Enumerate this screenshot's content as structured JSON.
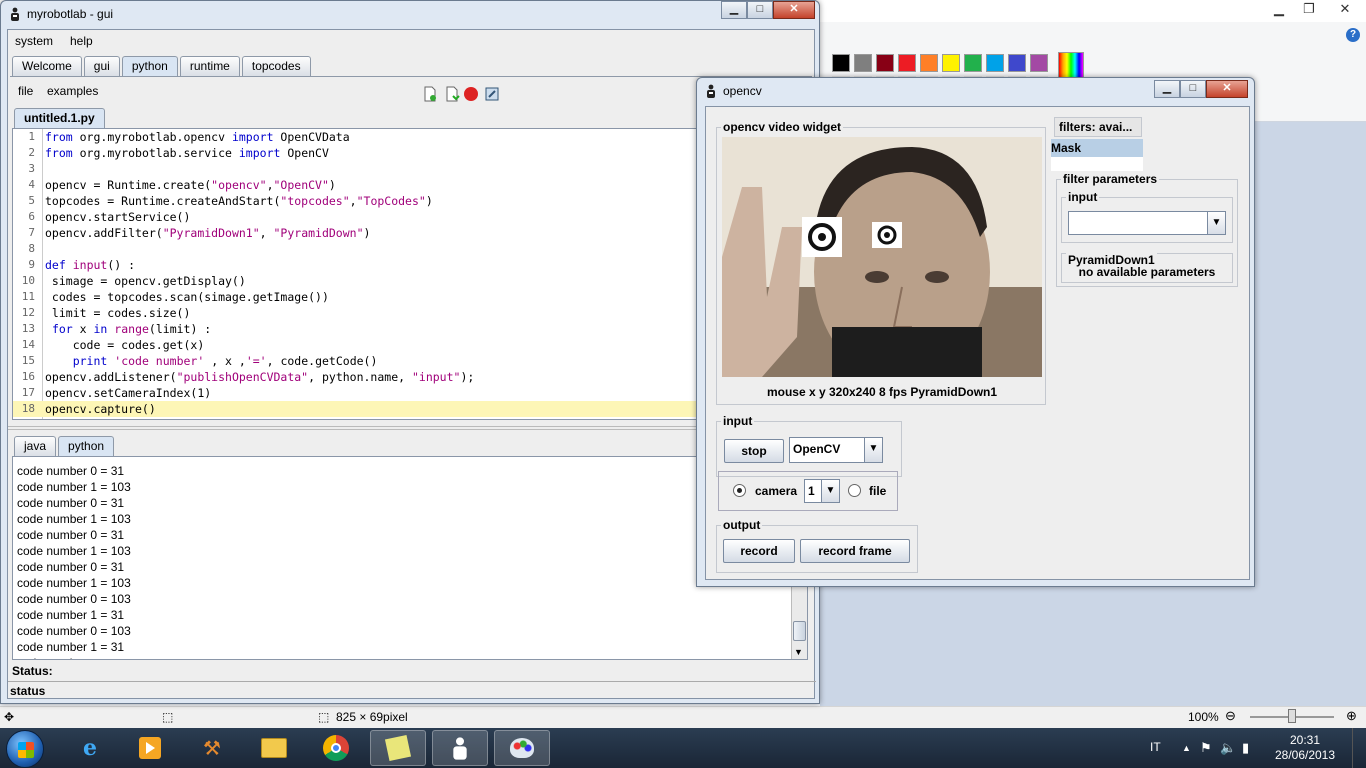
{
  "paint": {
    "colors": [
      "#000000",
      "#7f7f7f",
      "#880015",
      "#ed1c24",
      "#ff7f27",
      "#fff200",
      "#22b14c",
      "#00a2e8",
      "#3f48cc",
      "#a349a4"
    ],
    "status": {
      "size": "825 × 69pixel",
      "zoom": "100%",
      "zoom_level": 0.5
    }
  },
  "mrl": {
    "title": "myrobotlab - gui",
    "menu": [
      "system",
      "help"
    ],
    "tabs": [
      "Welcome",
      "gui",
      "python",
      "runtime",
      "topcodes"
    ],
    "selected_tab": "python",
    "submenu": [
      "file",
      "examples"
    ],
    "file_tab": "untitled.1.py",
    "code": [
      "from org.myrobotlab.opencv import OpenCVData",
      "from org.myrobotlab.service import OpenCV",
      "",
      "opencv = Runtime.create(\"opencv\",\"OpenCV\")",
      "topcodes = Runtime.createAndStart(\"topcodes\",\"TopCodes\")",
      "opencv.startService()",
      "opencv.addFilter(\"PyramidDown1\", \"PyramidDown\")",
      "",
      "def input() :",
      " simage = opencv.getDisplay()",
      " codes = topcodes.scan(simage.getImage())",
      " limit = codes.size()",
      " for x in range(limit) :",
      "    code = codes.get(x)",
      "    print 'code number' , x ,'=', code.getCode()",
      "opencv.addListener(\"publishOpenCVData\", python.name, \"input\");",
      "opencv.setCameraIndex(1)",
      "opencv.capture()"
    ],
    "console_tabs": [
      "java",
      "python"
    ],
    "console": [
      "code number 0 = 31",
      "code number 1 = 103",
      "code number 0 = 31",
      "code number 1 = 103",
      "code number 0 = 31",
      "code number 1 = 103",
      "code number 0 = 31",
      "code number 1 = 103",
      "code number 0 = 103",
      "code number 1 = 31",
      "code number 0 = 103",
      "code number 1 = 31",
      "code number"
    ],
    "status_label": "Status:",
    "status_value": "status"
  },
  "opencv": {
    "title": "opencv",
    "video_label": "opencv  video widget",
    "video_caption": "mouse x y  320x240  8 fps  PyramidDown1",
    "filters_label": "filters: avai...",
    "filter_item": "Mask",
    "filter_params_label": "filter parameters",
    "input_label": "input",
    "pyramid_label": "PyramidDown1",
    "no_params": "no available parameters",
    "input_group": "input",
    "stop": "stop",
    "source": "OpenCV",
    "camera_label": "camera",
    "camera_index": "1",
    "file_label": "file",
    "output_group": "output",
    "record": "record",
    "record_frame": "record frame"
  },
  "taskbar": {
    "lang": "IT",
    "time": "20:31",
    "date": "28/06/2013"
  }
}
